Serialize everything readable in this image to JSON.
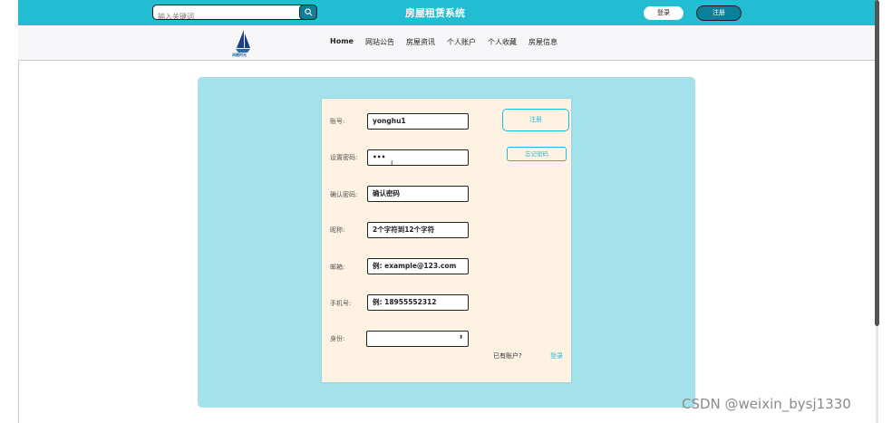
{
  "header": {
    "search": {
      "placeholder": "输入关键词"
    },
    "site_title": "房屋租赁系统",
    "login_label": "登录",
    "register_label": "注册"
  },
  "nav": {
    "logo_text": "闲暇时光",
    "items": [
      "Home",
      "网站公告",
      "房屋资讯",
      "个人账户",
      "个人收藏",
      "房屋信息"
    ]
  },
  "form": {
    "fields": [
      {
        "label": "账号:",
        "value": "yonghu1"
      },
      {
        "label": "设置密码:",
        "value": "•••"
      },
      {
        "label": "确认密码:",
        "value": "确认密码"
      },
      {
        "label": "昵称:",
        "value": "2个字符到12个字符"
      },
      {
        "label": "邮箱:",
        "value": "例: example@123.com"
      },
      {
        "label": "手机号:",
        "value": "例: 18955552312"
      }
    ],
    "identity": {
      "label": "身份:",
      "value": ""
    },
    "register_button": "注册",
    "forgot_button": "忘记密码",
    "have_account": "已有账户?",
    "login_link": "登录"
  },
  "watermark": "CSDN @weixin_bysj1330",
  "colors": {
    "accent": "#22bcd3",
    "panel": "#a3e1eb",
    "card": "#fef2e3"
  }
}
